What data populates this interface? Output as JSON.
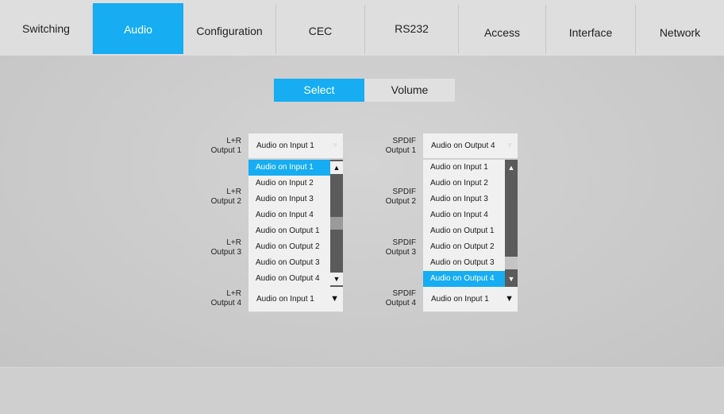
{
  "nav": {
    "tabs": [
      {
        "label": "Switching"
      },
      {
        "label": "Audio",
        "active": true
      },
      {
        "label": "Configuration"
      },
      {
        "label": "CEC"
      },
      {
        "label": "RS232"
      },
      {
        "label": "Access"
      },
      {
        "label": "Interface"
      },
      {
        "label": "Network"
      }
    ]
  },
  "segment": {
    "select_label": "Select",
    "volume_label": "Volume",
    "active": "Select"
  },
  "lr": {
    "labels": [
      {
        "line1": "L+R",
        "line2": "Output 1"
      },
      {
        "line1": "L+R",
        "line2": "Output 2"
      },
      {
        "line1": "L+R",
        "line2": "Output 3"
      },
      {
        "line1": "L+R",
        "line2": "Output 4"
      }
    ],
    "output1_value": "Audio on Input 1",
    "output4_value": "Audio on Input 1",
    "dropdown": {
      "options": [
        "Audio on Input 1",
        "Audio on Input 2",
        "Audio on Input 3",
        "Audio on Input 4",
        "Audio on Output 1",
        "Audio on Output 2",
        "Audio on Output 3",
        "Audio on Output 4"
      ],
      "highlighted": "Audio on Input 1"
    }
  },
  "spdif": {
    "labels": [
      {
        "line1": "SPDIF",
        "line2": "Output 1"
      },
      {
        "line1": "SPDIF",
        "line2": "Output 2"
      },
      {
        "line1": "SPDIF",
        "line2": "Output 3"
      },
      {
        "line1": "SPDIF",
        "line2": "Output 4"
      }
    ],
    "output1_value": "Audio on Output 4",
    "output4_value": "Audio on Input 1",
    "dropdown": {
      "options": [
        "Audio on Input 1",
        "Audio on Input 2",
        "Audio on Input 3",
        "Audio on Input 4",
        "Audio on Output 1",
        "Audio on Output 2",
        "Audio on Output 3",
        "Audio on Output 4"
      ],
      "highlighted": "Audio on Output 4"
    }
  },
  "icons": {
    "up": "triangle-up-icon",
    "down": "triangle-down-icon"
  }
}
